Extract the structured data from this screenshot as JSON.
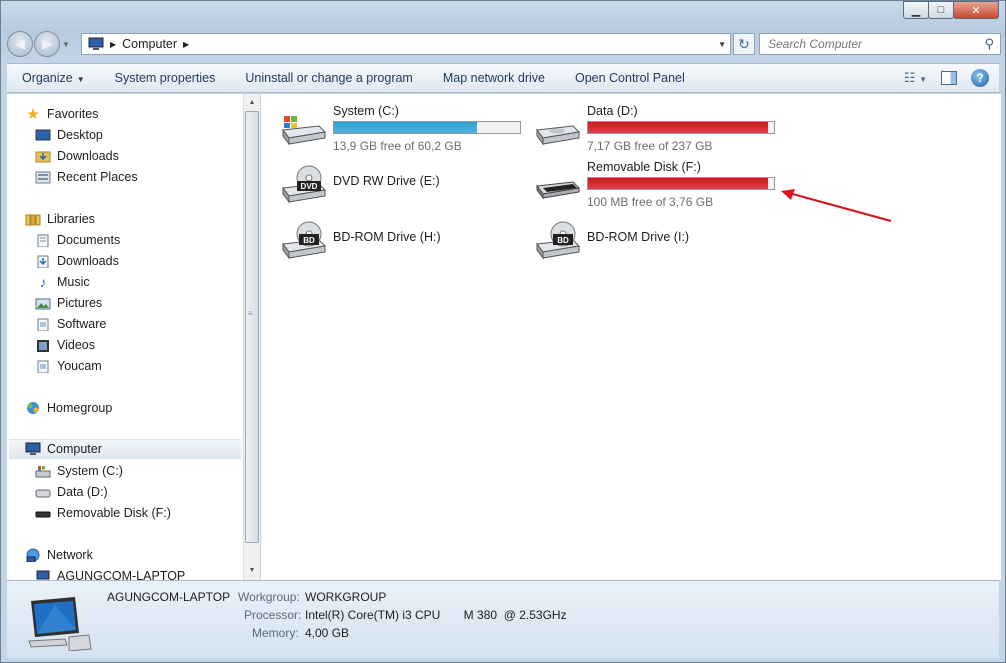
{
  "window": {
    "caption_minimize": "▁",
    "caption_maximize": "□",
    "caption_close": "✕"
  },
  "address": {
    "crumb": "Computer",
    "search_placeholder": "Search Computer"
  },
  "toolbar": {
    "organize": "Organize",
    "system_properties": "System properties",
    "uninstall": "Uninstall or change a program",
    "map_drive": "Map network drive",
    "control_panel": "Open Control Panel",
    "help": "?"
  },
  "nav": {
    "favorites": "Favorites",
    "desktop": "Desktop",
    "downloads_fav": "Downloads",
    "recent": "Recent Places",
    "libraries": "Libraries",
    "documents": "Documents",
    "downloads_lib": "Downloads",
    "music": "Music",
    "pictures": "Pictures",
    "software": "Software",
    "videos": "Videos",
    "youcam": "Youcam",
    "homegroup": "Homegroup",
    "computer": "Computer",
    "system_c": "System (C:)",
    "data_d": "Data (D:)",
    "removable_f": "Removable Disk (F:)",
    "network": "Network",
    "laptop": "AGUNGCOM-LAPTOP"
  },
  "drives": {
    "c": {
      "name": "System (C:)",
      "free": "13,9 GB free of 60,2 GB",
      "used_fraction": 0.77,
      "color": "#2aa3d6"
    },
    "d": {
      "name": "Data (D:)",
      "free": "7,17 GB free of 237 GB",
      "used_fraction": 0.97,
      "color": "#d9141c"
    },
    "e": {
      "name": "DVD RW Drive (E:)"
    },
    "f": {
      "name": "Removable Disk (F:)",
      "free": "100 MB free of 3,76 GB",
      "used_fraction": 0.97,
      "color": "#d9141c"
    },
    "h": {
      "name": "BD-ROM Drive (H:)"
    },
    "i": {
      "name": "BD-ROM Drive (I:)"
    }
  },
  "details": {
    "name": "AGUNGCOM-LAPTOP",
    "workgroup_label": "Workgroup:",
    "workgroup": "WORKGROUP",
    "processor_label": "Processor:",
    "processor": "Intel(R) Core(TM) i3 CPU       M 380  @ 2.53GHz",
    "memory_label": "Memory:",
    "memory": "4,00 GB"
  },
  "icons": {
    "dvd_label": "DVD",
    "bd_label": "BD"
  },
  "colors": {
    "annotation_arrow": "#d9141c"
  }
}
